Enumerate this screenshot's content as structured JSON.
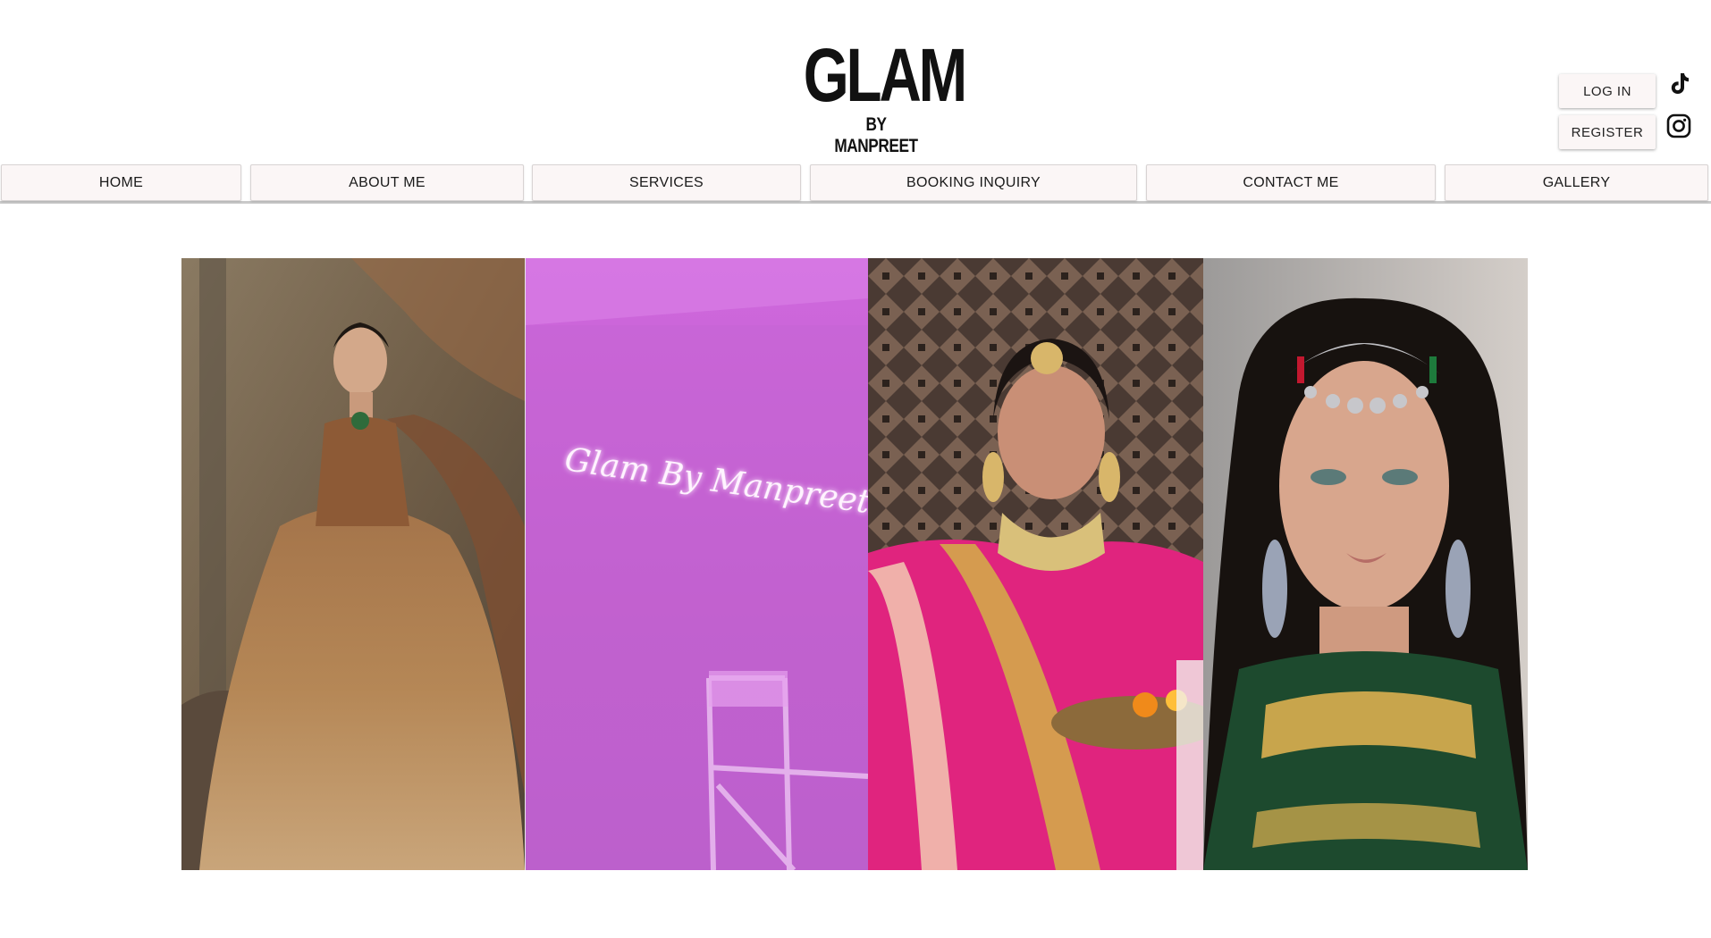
{
  "brand": {
    "logo_main": "GLAM",
    "logo_sub": "BY MANPREET"
  },
  "auth": {
    "login_label": "LOG IN",
    "register_label": "REGISTER"
  },
  "social": [
    {
      "name": "tiktok-icon"
    },
    {
      "name": "instagram-icon"
    }
  ],
  "nav": {
    "items": [
      {
        "label": "HOME"
      },
      {
        "label": "ABOUT ME"
      },
      {
        "label": "SERVICES"
      },
      {
        "label": "BOOKING INQUIRY"
      },
      {
        "label": "CONTACT ME"
      },
      {
        "label": "GALLERY"
      }
    ]
  },
  "gallery": {
    "neon_sign_text": "Glam By Manpreet",
    "photos": [
      {
        "name": "bride-gold-lehenga-photo"
      },
      {
        "name": "neon-sign-studio-photo"
      },
      {
        "name": "bride-pink-dupatta-photo"
      },
      {
        "name": "jewelled-headpiece-portrait-photo"
      }
    ]
  },
  "colors": {
    "nav_bg": "#fbf6f6",
    "text": "#1a1a1a",
    "studio_purple": "#c966d6",
    "bridal_pink": "#e0247e"
  }
}
